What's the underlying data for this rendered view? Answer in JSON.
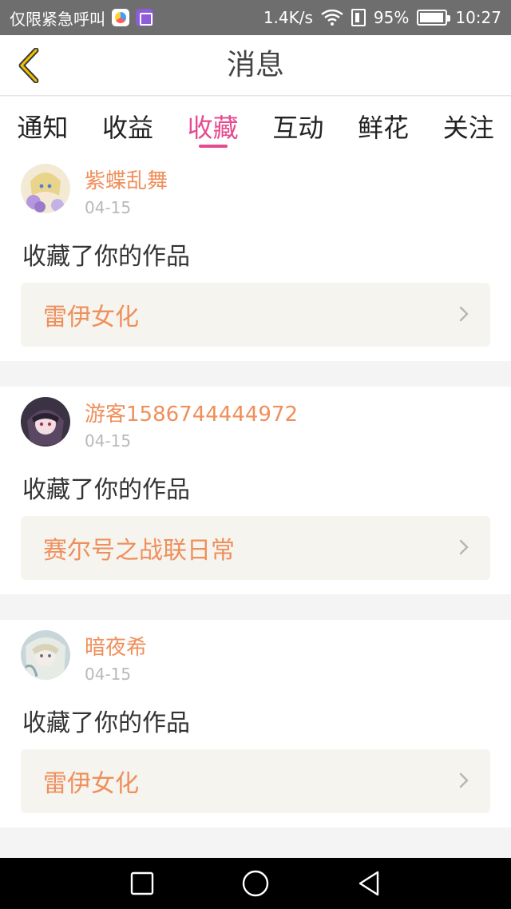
{
  "status_bar": {
    "carrier": "仅限紧急呼叫",
    "speed": "1.4K/s",
    "battery_percent": "95%",
    "battery_level": 0.95,
    "time": "10:27"
  },
  "nav": {
    "title": "消息"
  },
  "tabs": [
    {
      "label": "通知"
    },
    {
      "label": "收益"
    },
    {
      "label": "收藏"
    },
    {
      "label": "互动"
    },
    {
      "label": "鲜花"
    },
    {
      "label": "关注"
    }
  ],
  "messages": [
    {
      "username": "紫蝶乱舞",
      "date": "04-15",
      "action": "收藏了你的作品",
      "work_title": "雷伊女化"
    },
    {
      "username": "游客1586744444972",
      "date": "04-15",
      "action": "收藏了你的作品",
      "work_title": "赛尔号之战联日常"
    },
    {
      "username": "暗夜希",
      "date": "04-15",
      "action": "收藏了你的作品",
      "work_title": "雷伊女化"
    }
  ],
  "colors": {
    "accent": "#e64b8f",
    "name": "#ef8f5b",
    "date": "#b9b9b9"
  }
}
